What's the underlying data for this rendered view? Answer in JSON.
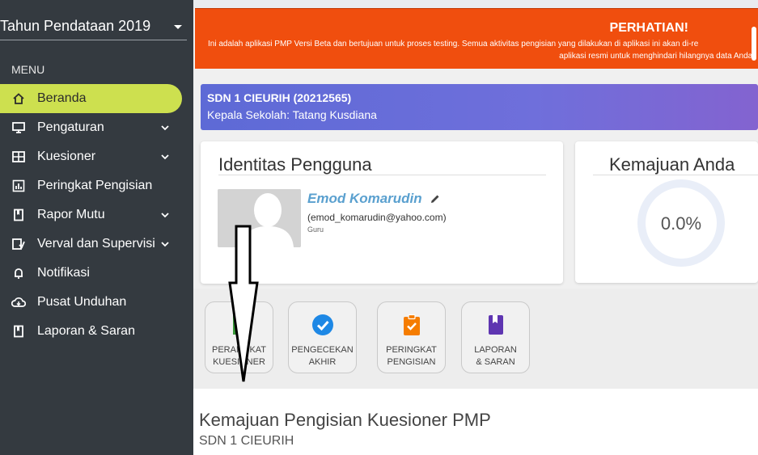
{
  "sidebar": {
    "year_select": "Tahun Pendataan 2019",
    "menu_header": "MENU",
    "items": [
      {
        "label": "Beranda",
        "icon": "home-icon",
        "expandable": false,
        "active": true
      },
      {
        "label": "Pengaturan",
        "icon": "monitor-icon",
        "expandable": true
      },
      {
        "label": "Kuesioner",
        "icon": "grid-icon",
        "expandable": true
      },
      {
        "label": "Peringkat Pengisian",
        "icon": "bar-chart-icon",
        "expandable": false
      },
      {
        "label": "Rapor Mutu",
        "icon": "book-icon",
        "expandable": true
      },
      {
        "label": "Verval dan Supervisi",
        "icon": "verify-icon",
        "expandable": true
      },
      {
        "label": "Notifikasi",
        "icon": "bell-icon",
        "expandable": false
      },
      {
        "label": "Pusat Unduhan",
        "icon": "cloud-download-icon",
        "expandable": false
      },
      {
        "label": "Laporan & Saran",
        "icon": "book-icon",
        "expandable": false
      }
    ]
  },
  "alert": {
    "title": "PERHATIAN!",
    "line1": "Ini adalah aplikasi PMP Versi Beta dan bertujuan untuk proses testing. Semua aktivitas pengisian yang dilakukan di aplikasi ini akan di-re",
    "line2": "aplikasi resmi untuk menghindari hilangnya data Anda!",
    "color": "#f04e0e"
  },
  "school": {
    "name": "SDN 1 CIEURIH (20212565)",
    "head": "Kepala Sekolah: Tatang Kusdiana"
  },
  "identity": {
    "title": "Identitas Pengguna",
    "name": "Emod Komarudin",
    "email": "(emod_komarudin@yahoo.com)",
    "role": "Guru"
  },
  "progress": {
    "title": "Kemajuan Anda",
    "value": "0.0%"
  },
  "tiles": [
    {
      "line1": "PERANGKAT",
      "line2": "KUESIONER",
      "icon": "document-icon",
      "color": "#3a9a3a"
    },
    {
      "line1": "PENGECEKAN",
      "line2": "AKHIR",
      "icon": "check-circle-icon",
      "color": "#1e88e5"
    },
    {
      "line1": "PERINGKAT",
      "line2": "PENGISIAN",
      "icon": "clipboard-check-icon",
      "color": "#f57c00"
    },
    {
      "line1": "LAPORAN",
      "line2": "& SARAN",
      "icon": "bookmark-book-icon",
      "color": "#5e35b1"
    }
  ],
  "section": {
    "title": "Kemajuan Pengisian Kuesioner PMP",
    "subtitle": "SDN 1 CIEURIH"
  }
}
